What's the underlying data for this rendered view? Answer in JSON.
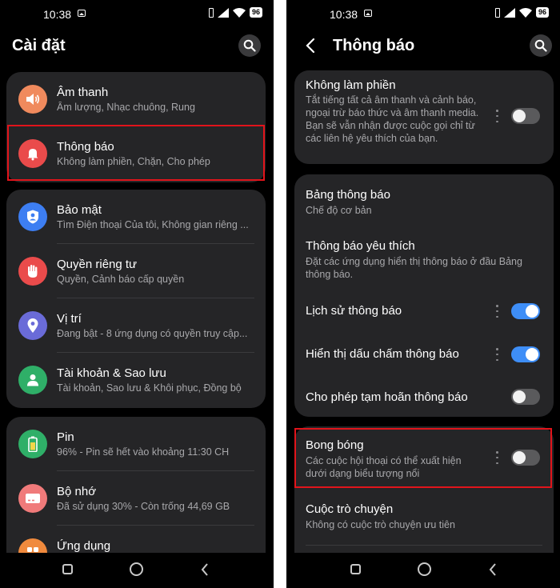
{
  "status": {
    "time": "10:38",
    "battery": "96"
  },
  "left": {
    "title": "Cài đặt",
    "card1": [
      {
        "title": "Âm thanh",
        "subtitle": "Âm lượng, Nhạc chuông, Rung",
        "icon": "speaker-icon",
        "color": "#f08a5d"
      },
      {
        "title": "Thông báo",
        "subtitle": "Không làm phiền, Chặn, Cho phép",
        "icon": "bell-icon",
        "color": "#ea4b4b"
      }
    ],
    "card2": [
      {
        "title": "Bảo mật",
        "subtitle": "Tìm Điện thoại Của tôi, Không gian riêng ...",
        "icon": "shield-user-icon",
        "color": "#3d7ef2"
      },
      {
        "title": "Quyền riêng tư",
        "subtitle": "Quyền, Cảnh báo cấp quyền",
        "icon": "hand-icon",
        "color": "#ea4b4b"
      },
      {
        "title": "Vị trí",
        "subtitle": "Đang bật - 8 ứng dụng có quyền truy cập...",
        "icon": "location-pin-icon",
        "color": "#6a6bd8"
      },
      {
        "title": "Tài khoản & Sao lưu",
        "subtitle": "Tài khoản, Sao lưu & Khôi phục, Đồng bộ",
        "icon": "account-icon",
        "color": "#2faf68"
      }
    ],
    "card3": [
      {
        "title": "Pin",
        "subtitle": "96% - Pin sẽ hết vào khoảng 11:30 CH",
        "icon": "battery-icon",
        "color": "#2faf68"
      },
      {
        "title": "Bộ nhớ",
        "subtitle": "Đã sử dụng 30% - Còn trống 44,69 GB",
        "icon": "storage-icon",
        "color": "#f07a7a"
      },
      {
        "title": "Ứng dụng",
        "subtitle": "",
        "icon": "apps-icon",
        "color": "#f08a3d"
      }
    ]
  },
  "right": {
    "title": "Thông báo",
    "dnd": {
      "title": "Không làm phiền",
      "subtitle": "Tắt tiếng tất cả âm thanh và cảnh báo, ngoại trừ báo thức và âm thanh media. Bạn sẽ vẫn nhận được cuộc gọi chỉ từ các liên hệ yêu thích của bạn.",
      "on": false
    },
    "panel": {
      "title": "Bảng thông báo",
      "subtitle": "Chế độ cơ bản"
    },
    "favorite": {
      "title": "Thông báo yêu thích",
      "subtitle": "Đặt các ứng dụng hiển thị thông báo ở đầu Bảng thông báo."
    },
    "history": {
      "title": "Lịch sử thông báo",
      "on": true
    },
    "dots": {
      "title": "Hiển thị dấu chấm thông báo",
      "on": true
    },
    "snooze": {
      "title": "Cho phép tạm hoãn thông báo",
      "on": false
    },
    "bubbles": {
      "title": "Bong bóng",
      "subtitle": "Các cuộc hội thoại có thể xuất hiện dưới dạng biểu tượng nổi",
      "on": false
    },
    "conversations": {
      "title": "Cuộc trò chuyện",
      "subtitle": "Không có cuộc trò chuyện ưu tiên"
    }
  },
  "colors": {
    "highlight": "#e1141b",
    "toggle_on": "#3e8ef7",
    "card_bg": "#252527"
  }
}
